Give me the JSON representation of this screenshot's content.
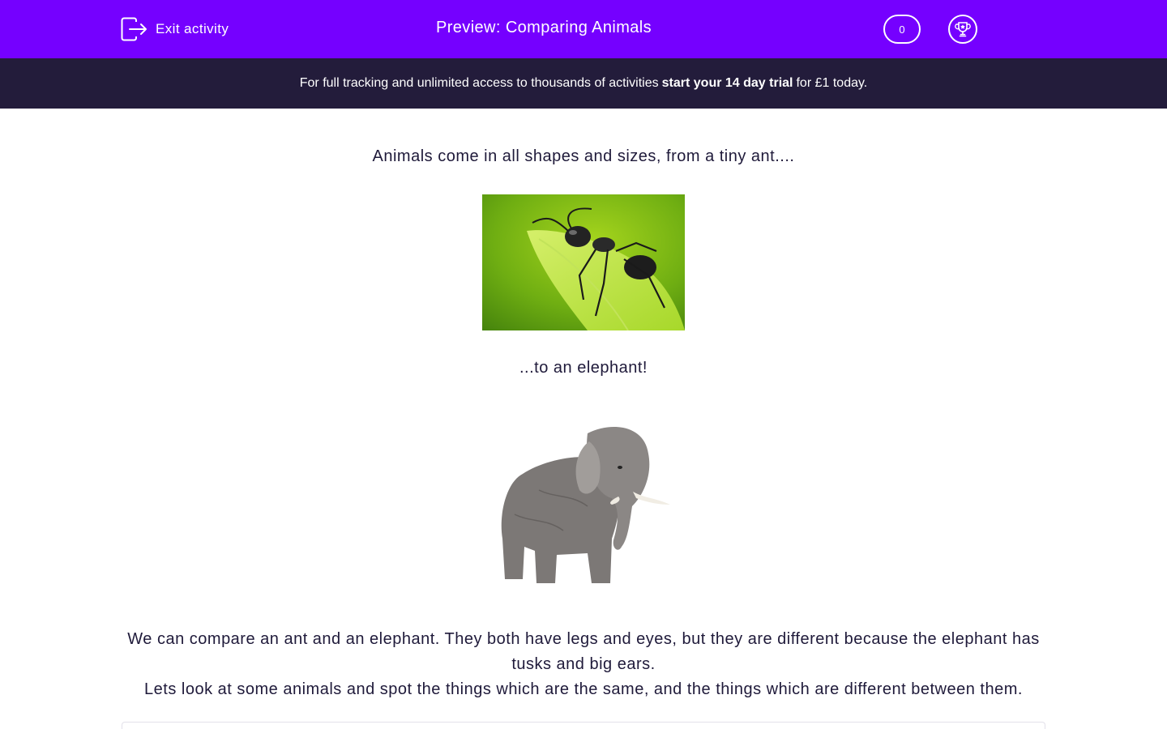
{
  "header": {
    "exit_label": "Exit activity",
    "title": "Preview: Comparing Animals",
    "score": "0",
    "background_color": "#7500ff"
  },
  "promo": {
    "before": "For full tracking and unlimited access to thousands of activities",
    "link": "start your 14 day trial",
    "after": "for £1 today.",
    "background_color": "#231c3b"
  },
  "content": {
    "intro": "Animals come in all shapes and sizes, from a tiny ant....",
    "mid": "...to an elephant!",
    "paragraph_line1": "We can compare an ant and an elephant.  They both have legs and eyes, but they are different because the elephant has tusks and big ears.",
    "paragraph_line2": "Lets look at some animals and spot the things which are the same, and the things which are different between them."
  },
  "icons": {
    "exit": "exit-icon",
    "trophy": "trophy-icon"
  }
}
